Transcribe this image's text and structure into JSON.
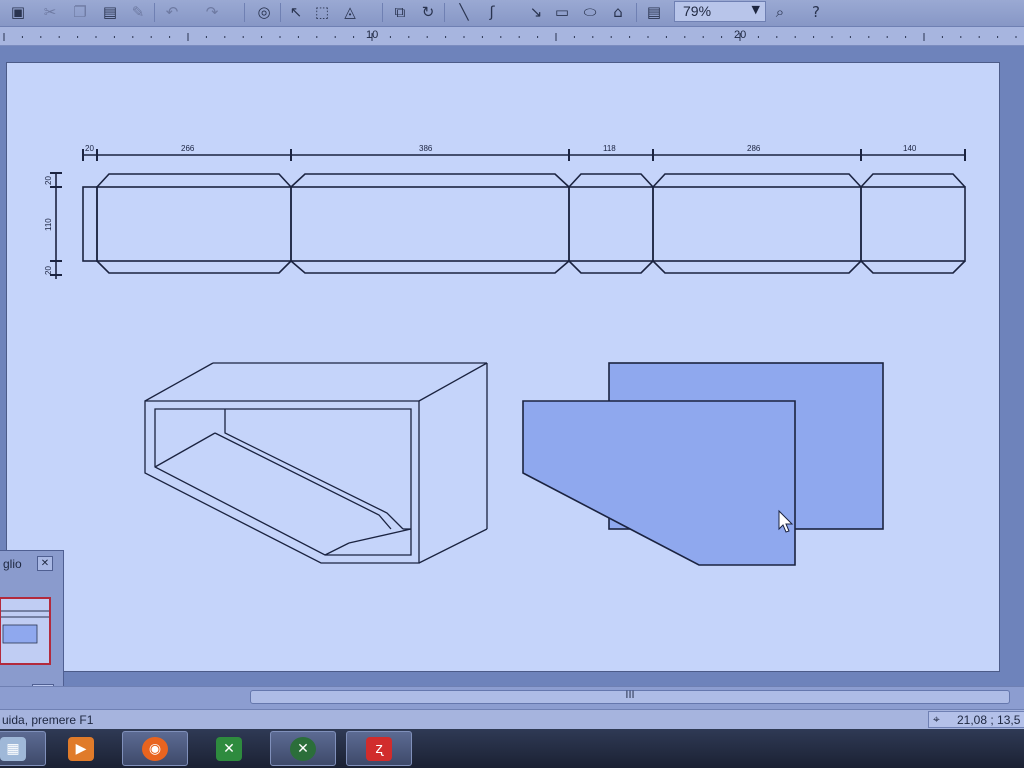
{
  "toolbar": {
    "icons": [
      "camera-icon",
      "cut-icon",
      "copy-icon",
      "paste-icon",
      "brush-icon",
      "undo-icon",
      "redo-icon",
      "navigator-icon",
      "select-arrow-icon",
      "select-frame-icon",
      "fill-icon",
      "arrange-icon",
      "rotate-icon",
      "line-icon",
      "curve-icon",
      "arrow-icon",
      "rectangle-icon",
      "ellipse-icon",
      "shapes-icon",
      "text-icon"
    ],
    "zoom_value": "79%"
  },
  "ruler": {
    "labels": [
      "10",
      "20"
    ]
  },
  "drawing": {
    "dimensions_top": [
      "20",
      "266",
      "386",
      "118",
      "286",
      "140"
    ],
    "dimensions_left": [
      "20",
      "110",
      "20"
    ],
    "background": "#c5d4fa",
    "line_color": "#1b2340",
    "shape_fill": "#8fa8ee"
  },
  "navigator": {
    "title": "glio",
    "zoom": "%"
  },
  "hscroll": {
    "grip": "III"
  },
  "statusbar": {
    "text": "uida, premere F1",
    "position": "21,08 ; 13,5"
  },
  "taskbar": {
    "apps": [
      {
        "name": "explorer",
        "color": "#9fb8d8"
      },
      {
        "name": "media-player",
        "color": "#e07b2a"
      },
      {
        "name": "firefox",
        "color": "#e8641f"
      },
      {
        "name": "excel",
        "color": "#2e8b3e"
      },
      {
        "name": "xara",
        "color": "#2b6e3a"
      },
      {
        "name": "corel",
        "color": "#d12c2c"
      }
    ]
  }
}
